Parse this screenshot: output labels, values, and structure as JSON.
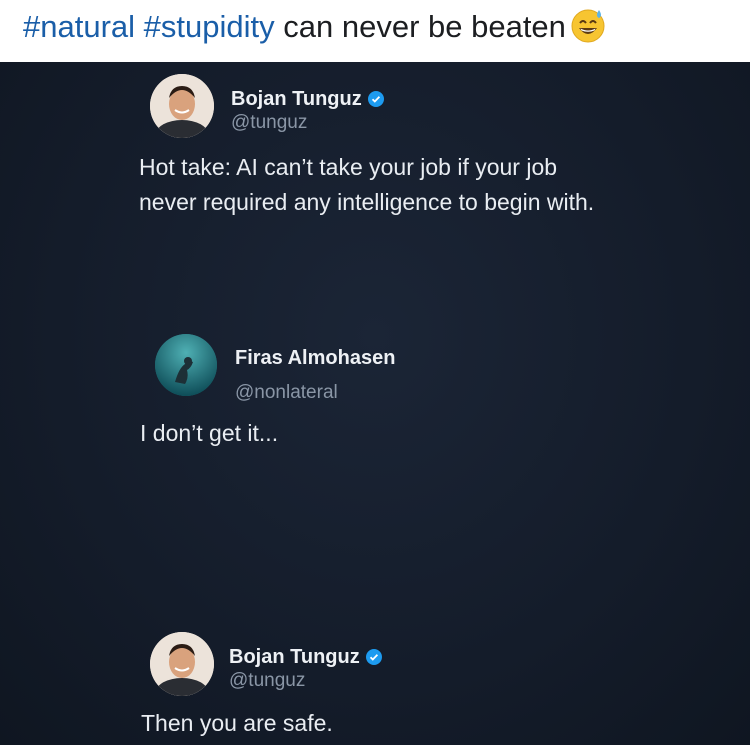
{
  "caption": {
    "hashtag_1": "#natural",
    "hashtag_2": "#stupidity",
    "text": "can never be beaten",
    "emoji": "grinning-sweat-emoji"
  },
  "tweets": [
    {
      "name": "Bojan Tunguz",
      "handle": "@tunguz",
      "verified": true,
      "body": "Hot take: AI can’t take your job if your job never required any intelligence to begin with."
    },
    {
      "name": "Firas Almohasen",
      "handle": "@nonlateral",
      "verified": false,
      "body": "I don’t get it..."
    },
    {
      "name": "Bojan Tunguz",
      "handle": "@tunguz",
      "verified": true,
      "body": "Then you are safe."
    }
  ],
  "colors": {
    "hashtag": "#1a5ea8",
    "background": "#141c2a",
    "verified_badge": "#1d9bf0"
  }
}
